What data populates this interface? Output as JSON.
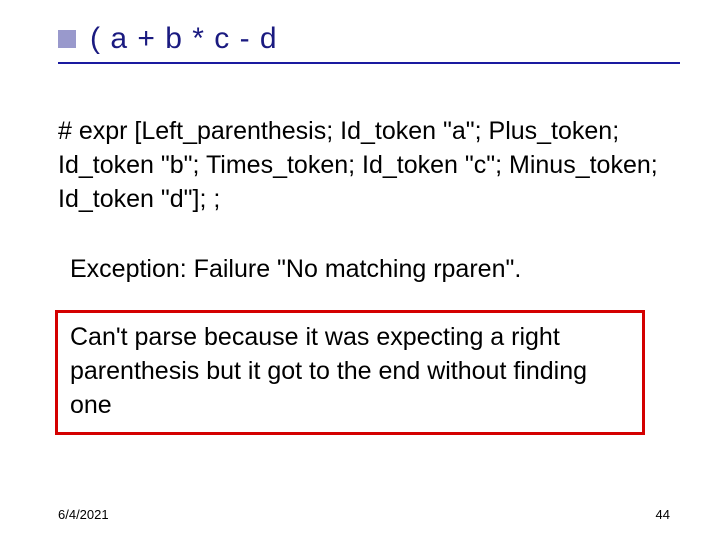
{
  "title": "( a + b * c - d",
  "code": "# expr [Left_parenthesis; Id_token \"a\"; Plus_token; Id_token \"b\"; Times_token; Id_token \"c\"; Minus_token; Id_token \"d\"]; ;",
  "exception": "Exception: Failure \"No matching rparen\".",
  "explanation": "Can't parse because it was expecting a right parenthesis but it got to the end without finding one",
  "footer": {
    "date": "6/4/2021",
    "page": "44"
  }
}
